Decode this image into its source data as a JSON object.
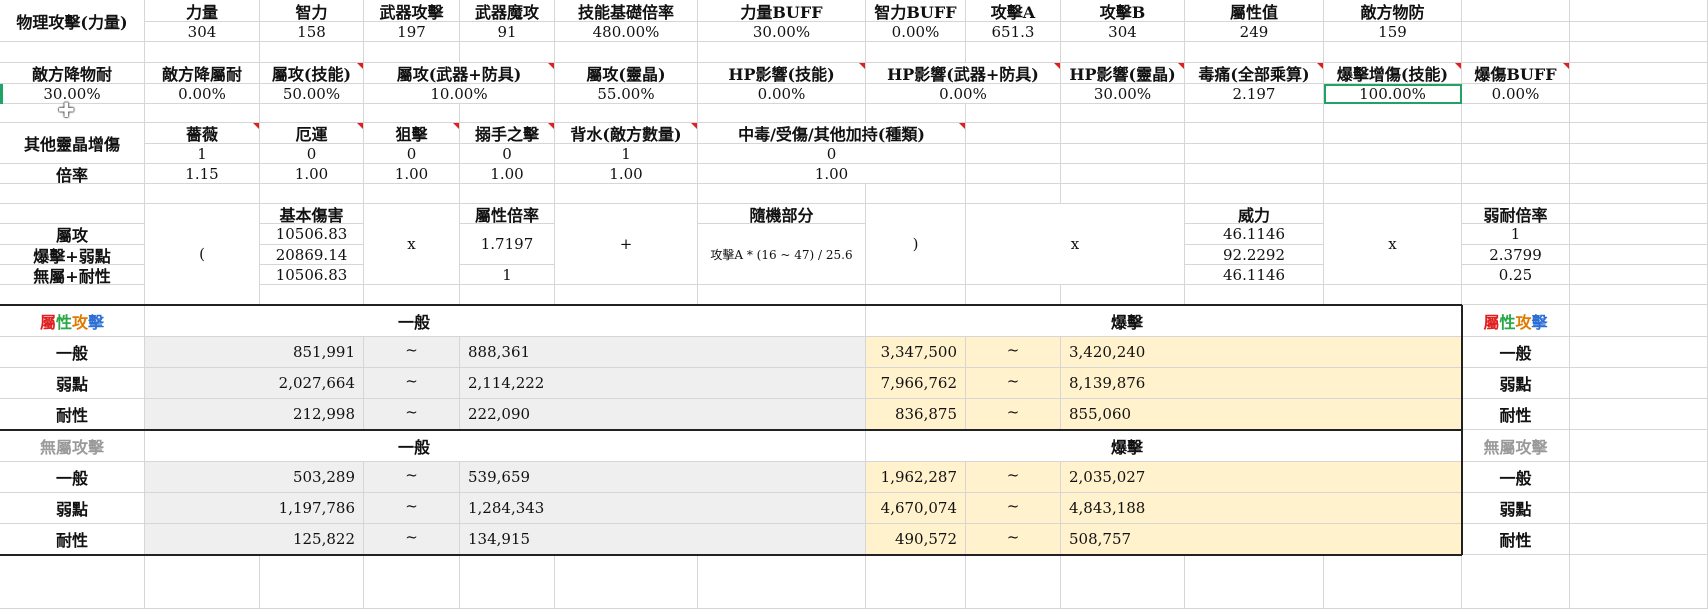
{
  "row1": {
    "label": "物理攻擊(力量)",
    "headers": [
      "力量",
      "智力",
      "武器攻擊",
      "武器魔攻",
      "技能基礎倍率",
      "力量BUFF",
      "智力BUFF",
      "攻擊A",
      "攻擊B",
      "屬性值",
      "敵方物防"
    ],
    "values": [
      "304",
      "158",
      "197",
      "91",
      "480.00%",
      "30.00%",
      "0.00%",
      "651.3",
      "304",
      "249",
      "159"
    ]
  },
  "row2": {
    "headers": [
      "敵方降物耐",
      "敵方降屬耐",
      "屬攻(技能)",
      "屬攻(武器+防具)",
      "屬攻(靈晶)",
      "HP影響(技能)",
      "HP影響(武器+防具)",
      "HP影響(靈晶)",
      "毒痛(全部乘算)",
      "爆擊增傷(技能)",
      "爆傷BUFF"
    ],
    "values": [
      "30.00%",
      "0.00%",
      "50.00%",
      "10.00%",
      "55.00%",
      "0.00%",
      "0.00%",
      "30.00%",
      "2.197",
      "100.00%",
      "0.00%"
    ]
  },
  "crystal": {
    "label": "其他靈晶增傷",
    "rate_label": "倍率",
    "headers": [
      "薔薇",
      "厄運",
      "狙擊",
      "搦手之擊",
      "背水(敵方數量)",
      "中毒/受傷/其他加持(種類)"
    ],
    "counts": [
      "1",
      "0",
      "0",
      "0",
      "1",
      "0"
    ],
    "rates": [
      "1.15",
      "1.00",
      "1.00",
      "1.00",
      "1.00",
      "1.00"
    ]
  },
  "formula": {
    "row_labels": [
      "屬攻",
      "爆擊+弱點",
      "無屬+耐性"
    ],
    "open_paren": "(",
    "base_header": "基本傷害",
    "base_values": [
      "10506.83",
      "20869.14",
      "10506.83"
    ],
    "times": "x",
    "attr_header": "屬性倍率",
    "attr_values": [
      "1.7197",
      "1"
    ],
    "plus": "+",
    "random_header": "隨機部分",
    "random_formula": "攻擊A * (16 ~ 47) / 25.6",
    "close_paren": ")",
    "power_header": "威力",
    "power_values": [
      "46.1146",
      "92.2292",
      "46.1146"
    ],
    "weak_header": "弱耐倍率",
    "weak_values": [
      "1",
      "2.3799",
      "0.25"
    ]
  },
  "attr_table": {
    "title_chars": [
      "屬",
      "性",
      "攻",
      "擊"
    ],
    "title_colors": [
      "#e02020",
      "#27a844",
      "#e07b00",
      "#2b6fd6"
    ],
    "normal_header": "一般",
    "crit_header": "爆擊",
    "tilde": "~",
    "rows": [
      {
        "label": "一般",
        "n_min": "851,991",
        "n_max": "888,361",
        "c_min": "3,347,500",
        "c_max": "3,420,240"
      },
      {
        "label": "弱點",
        "n_min": "2,027,664",
        "n_max": "2,114,222",
        "c_min": "7,966,762",
        "c_max": "8,139,876"
      },
      {
        "label": "耐性",
        "n_min": "212,998",
        "n_max": "222,090",
        "c_min": "836,875",
        "c_max": "855,060"
      }
    ]
  },
  "none_table": {
    "title": "無屬攻擊",
    "title_color": "#9a9a9a",
    "normal_header": "一般",
    "crit_header": "爆擊",
    "tilde": "~",
    "rows": [
      {
        "label": "一般",
        "n_min": "503,289",
        "n_max": "539,659",
        "c_min": "1,962,287",
        "c_max": "2,035,027"
      },
      {
        "label": "弱點",
        "n_min": "1,197,786",
        "n_max": "1,284,343",
        "c_min": "4,670,074",
        "c_max": "4,843,188"
      },
      {
        "label": "耐性",
        "n_min": "125,822",
        "n_max": "134,915",
        "c_min": "490,572",
        "c_max": "508,757"
      }
    ]
  }
}
